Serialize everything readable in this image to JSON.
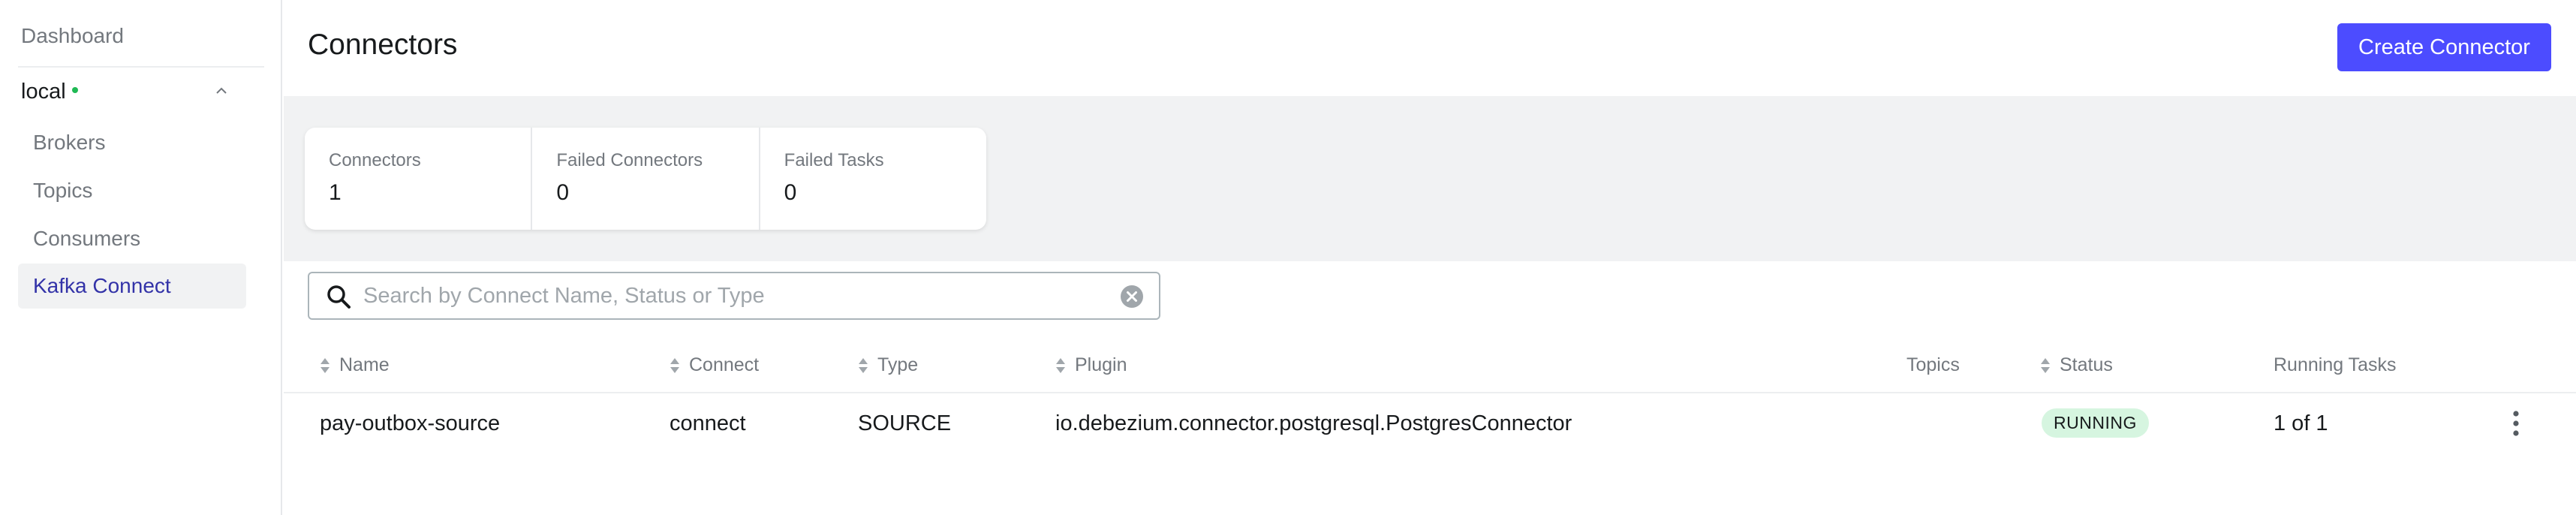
{
  "sidebar": {
    "dashboard": "Dashboard",
    "cluster": "local",
    "items": [
      {
        "label": "Brokers"
      },
      {
        "label": "Topics"
      },
      {
        "label": "Consumers"
      },
      {
        "label": "Kafka Connect"
      }
    ]
  },
  "header": {
    "title": "Connectors",
    "create_button": "Create Connector"
  },
  "metrics": [
    {
      "label": "Connectors",
      "value": "1"
    },
    {
      "label": "Failed Connectors",
      "value": "0"
    },
    {
      "label": "Failed Tasks",
      "value": "0"
    }
  ],
  "search": {
    "placeholder": "Search by Connect Name, Status or Type",
    "value": ""
  },
  "table": {
    "columns": [
      "Name",
      "Connect",
      "Type",
      "Plugin",
      "Topics",
      "Status",
      "Running Tasks"
    ],
    "rows": [
      {
        "name": "pay-outbox-source",
        "connect": "connect",
        "type": "SOURCE",
        "plugin": "io.debezium.connector.postgresql.PostgresConnector",
        "topics": "",
        "status": "RUNNING",
        "running_tasks": "1 of 1"
      }
    ]
  },
  "colors": {
    "accent": "#4c4cff",
    "active_nav_text": "#3333a8",
    "status_running_bg": "#d6f5e0",
    "cluster_online_dot": "#1fb954"
  },
  "icons": [
    "chevron-up-icon",
    "search-icon",
    "clear-icon",
    "sort-icon",
    "kebab-menu-icon"
  ]
}
